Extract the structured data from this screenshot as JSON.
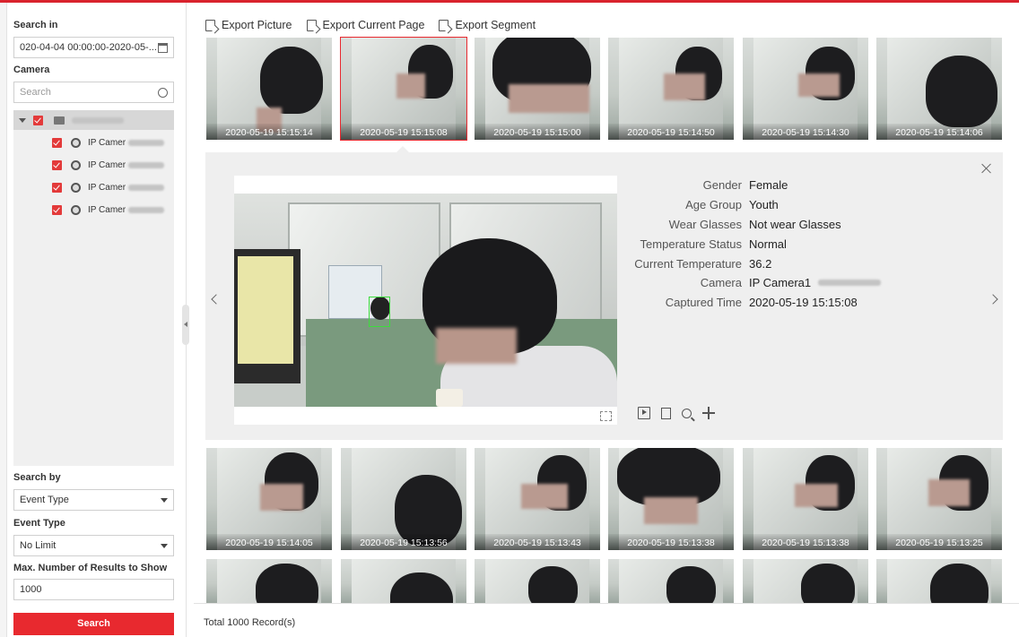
{
  "search": {
    "search_in_label": "Search in",
    "time_range": "020-04-04 00:00:00-2020-05-...",
    "camera_label": "Camera",
    "camera_search_placeholder": "Search",
    "cameras": [
      {
        "label": "IP Camer"
      },
      {
        "label": "IP Camer"
      },
      {
        "label": "IP Camer"
      },
      {
        "label": "IP Camer"
      }
    ],
    "search_by_label": "Search by",
    "search_by_value": "Event Type",
    "event_type_label": "Event Type",
    "event_type_value": "No Limit",
    "max_results_label": "Max. Number of Results to Show",
    "max_results_value": "1000",
    "search_button": "Search"
  },
  "toolbar": {
    "export_picture": "Export Picture",
    "export_current_page": "Export Current Page",
    "export_segment": "Export Segment"
  },
  "thumbnails_row1": [
    {
      "time": "2020-05-19 15:15:14"
    },
    {
      "time": "2020-05-19 15:15:08",
      "selected": true
    },
    {
      "time": "2020-05-19 15:15:00"
    },
    {
      "time": "2020-05-19 15:14:50"
    },
    {
      "time": "2020-05-19 15:14:30"
    },
    {
      "time": "2020-05-19 15:14:06"
    }
  ],
  "thumbnails_row2": [
    {
      "time": "2020-05-19 15:14:05"
    },
    {
      "time": "2020-05-19 15:13:56"
    },
    {
      "time": "2020-05-19 15:13:43"
    },
    {
      "time": "2020-05-19 15:13:38"
    },
    {
      "time": "2020-05-19 15:13:38"
    },
    {
      "time": "2020-05-19 15:13:25"
    }
  ],
  "detail": {
    "fields": [
      {
        "key": "Gender",
        "value": "Female"
      },
      {
        "key": "Age Group",
        "value": "Youth"
      },
      {
        "key": "Wear Glasses",
        "value": "Not wear Glasses"
      },
      {
        "key": "Temperature Status",
        "value": "Normal"
      },
      {
        "key": "Current Temperature",
        "value": "36.2"
      },
      {
        "key": "Camera",
        "value": "IP Camera1"
      },
      {
        "key": "Captured Time",
        "value": "2020-05-19 15:15:08"
      }
    ]
  },
  "footer": {
    "total": "Total 1000 Record(s)"
  },
  "colors": {
    "accent": "#e8292f"
  }
}
